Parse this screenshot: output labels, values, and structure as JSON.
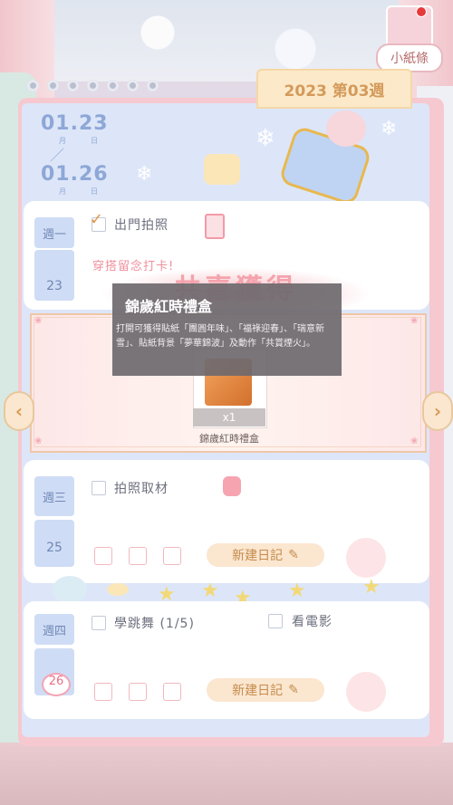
{
  "header": {
    "week_label": "2023 第03週",
    "memo_label": "小紙條"
  },
  "dates": {
    "start": "01.23",
    "end": "01.26",
    "month_label": "月",
    "day_label": "日",
    "separator": "／"
  },
  "days": [
    {
      "weekday": "週一",
      "date": "23",
      "tasks": [
        {
          "label": "出門拍照",
          "checked": true
        }
      ],
      "subtitle": "穿搭留念打卡!"
    },
    {
      "weekday": "週三",
      "date": "25",
      "tasks": [
        {
          "label": "拍照取材",
          "checked": false
        }
      ],
      "new_diary": "新建日記"
    },
    {
      "weekday": "週四",
      "date": "26",
      "tasks": [
        {
          "label": "學跳舞 (1/5)",
          "checked": false
        },
        {
          "label": "看電影",
          "checked": false
        }
      ],
      "new_diary": "新建日記"
    }
  ],
  "reward": {
    "banner_title": "共喜獲得",
    "item_name": "錦歲紅時禮盒",
    "item_count": "x1",
    "tooltip_title": "錦歲紅時禮盒",
    "tooltip_body": "打開可獲得貼紙「團圓年味」、「福祿迎春」、「瑞意新雪」、貼紙背景「夢華錦波」及動作「共賞煙火」。"
  },
  "nav": {
    "prev_glyph": "‹",
    "next_glyph": "›"
  },
  "colors": {
    "accent": "#d49a5a",
    "page": "#dde6f8",
    "notebook": "#f6c9d0",
    "tooltip": "#6e696e"
  }
}
